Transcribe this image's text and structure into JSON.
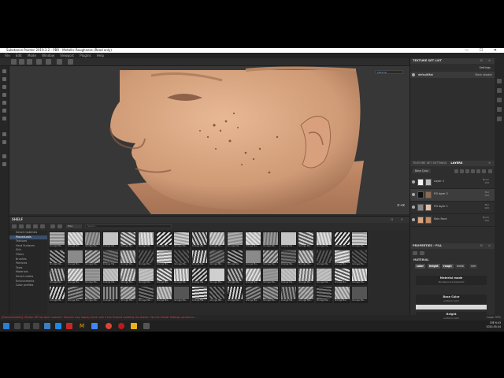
{
  "window": {
    "title": "Substance Painter 2019.3.2 - PBR - Metallic Roughness (Read only)",
    "controls": "— ☐ ✕"
  },
  "menu": [
    "File",
    "Edit",
    "Mode",
    "Window",
    "Viewport",
    "Plugins",
    "Help"
  ],
  "viewport": {
    "mode": "Material",
    "axis": "z→x"
  },
  "shelf": {
    "title": "SHELF",
    "controls": "⊟ ✕",
    "filter": "Proc",
    "search_placeholder": "Search...",
    "categories": [
      "Smart materials",
      "Procedurals",
      "Textures",
      "Hard Surfaces",
      "Skin",
      "Filters",
      "Brushes",
      "Particles",
      "Tools",
      "Materials",
      "Smart masks",
      "Environments",
      "Color profiles"
    ],
    "active_category": "Procedurals",
    "thumb_label": "Grunge Ma...",
    "rows": 4,
    "cols": 18
  },
  "status": {
    "message": "[Documentation]: Shader API has been updated. Textures may display blank until it has finished updating the shader. Use the Shader Settings window to ...",
    "cache": "Cache Disk Usage:  99%"
  },
  "texture_set_list": {
    "title": "TEXTURE SET LIST",
    "settings_label": "Settings",
    "item": "defaultMat",
    "shader": "Main shader"
  },
  "layers": {
    "tab_settings": "TEXTURE SET SETTINGS",
    "tab_layers": "LAYERS",
    "channel": "Base Color",
    "items": [
      {
        "name": "Layer 1",
        "blend": "Norm",
        "opacity": "100"
      },
      {
        "name": "Fill layer 2",
        "blend": "Mul",
        "opacity": "100"
      },
      {
        "name": "Fill layer 1",
        "blend": "Mul",
        "opacity": "100"
      },
      {
        "name": "Skin Face",
        "blend": "Norm",
        "opacity": "100"
      }
    ]
  },
  "properties": {
    "title": "PROPERTIES - FILL",
    "section": "MATERIAL",
    "channels": [
      "color",
      "height",
      "rough",
      "metal",
      "nrm"
    ],
    "material_mode_label": "Material mode",
    "material_mode_value": "No Resource Selected",
    "base_color_label": "Base Color",
    "base_color_sub": "uniform color",
    "height_label": "Height",
    "height_sub": "uniform color",
    "height_value": "0.0126",
    "height_level": 0.52,
    "roughness_label": "Roughness",
    "roughness_sub": "uniform color",
    "roughness_value": "0.0000",
    "roughness_level": 0.02
  },
  "tray": {
    "time": "오후 6:43",
    "date": "2020-05-04"
  },
  "colors": {
    "accent": "#3a4f69",
    "error": "#dd4444",
    "skin": "#d9a683"
  }
}
